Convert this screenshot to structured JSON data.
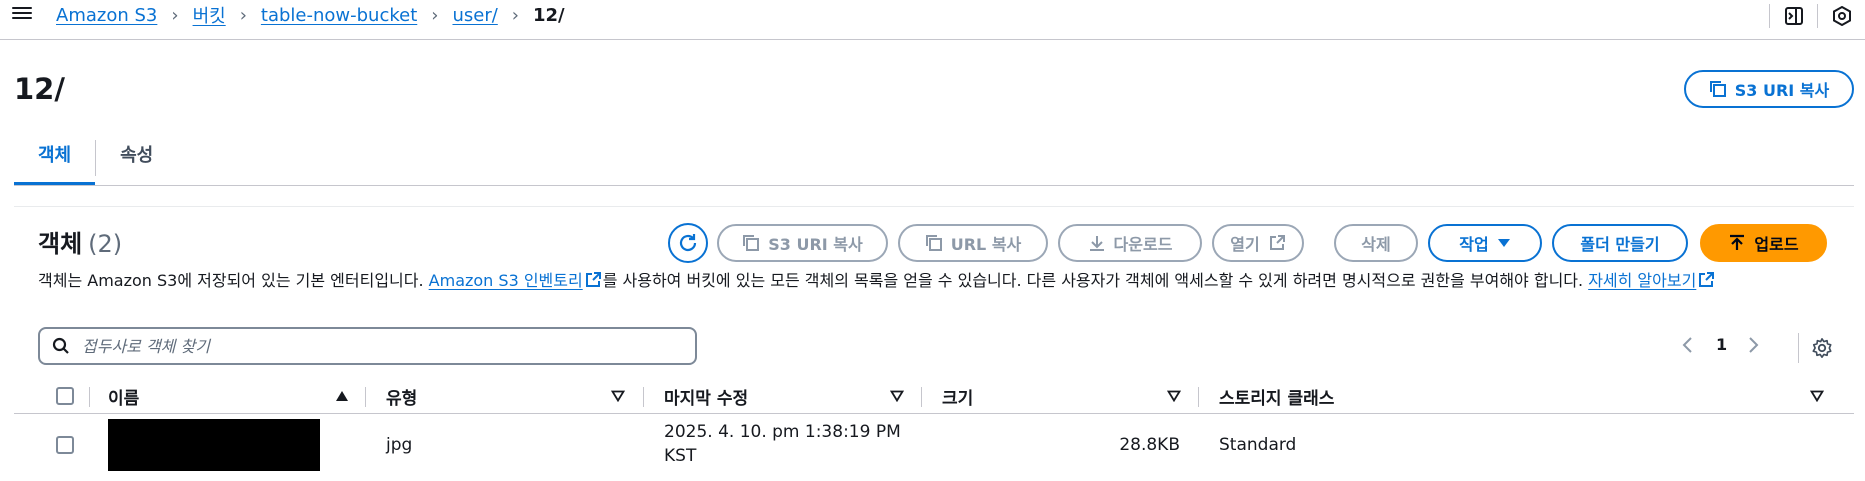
{
  "breadcrumb": {
    "items": [
      "Amazon S3",
      "버킷",
      "table-now-bucket",
      "user/"
    ],
    "current": "12/"
  },
  "page": {
    "title": "12/",
    "copy_uri_label": "S3 URI 복사"
  },
  "tabs": [
    {
      "label": "객체",
      "active": true
    },
    {
      "label": "속성",
      "active": false
    }
  ],
  "objects": {
    "title": "객체",
    "count": "(2)",
    "toolbar": {
      "copy_s3_uri": "S3 URI 복사",
      "copy_url": "URL 복사",
      "download": "다운로드",
      "open": "열기",
      "delete": "삭제",
      "actions": "작업",
      "create_folder": "폴더 만들기",
      "upload": "업로드"
    },
    "description": {
      "part1": "객체는 Amazon S3에 저장되어 있는 기본 엔터티입니다. ",
      "link1": "Amazon S3 인벤토리",
      "part2": "를 사용하여 버킷에 있는 모든 객체의 목록을 얻을 수 있습니다. 다른 사용자가 객체에 액세스할 수 있게 하려면 명시적으로 권한을 부여해야 합니다. ",
      "link2": "자세히 알아보기"
    },
    "search_placeholder": "접두사로 객체 찾기",
    "page_number": "1",
    "columns": [
      "이름",
      "유형",
      "마지막 수정",
      "크기",
      "스토리지 클래스"
    ],
    "rows": [
      {
        "name": "",
        "type": "jpg",
        "modified_line1": "2025. 4. 10. pm 1:38:19 PM",
        "modified_line2": "KST",
        "size": "28.8KB",
        "storage_class": "Standard"
      }
    ]
  },
  "colors": {
    "link_blue": "#0972d3",
    "upload_orange": "#ff9900",
    "disabled_gray": "#8d99a8"
  },
  "icons": [
    "menu-icon",
    "chevron-right-icon",
    "sidebar-panel-icon",
    "settings-hex-icon",
    "copy-icon",
    "refresh-icon",
    "download-icon",
    "external-link-icon",
    "caret-down-icon",
    "upload-icon",
    "search-icon",
    "chevron-left-icon",
    "gear-icon",
    "sort-asc-icon",
    "sort-desc-icon"
  ]
}
